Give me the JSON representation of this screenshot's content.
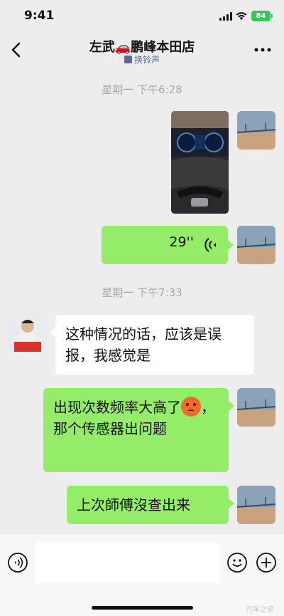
{
  "status_bar": {
    "time": "9:41",
    "battery": "84"
  },
  "header": {
    "title": "左武🚗鹏峰本田店",
    "subtitle": "换铃声"
  },
  "messages": {
    "timestamp_1": "星期一 下午6:28",
    "voice_duration": "29''",
    "timestamp_2": "星期一 下午7:33",
    "incoming_text": "这种情况的话，应该是误报，我感觉是",
    "outgoing_1_part1": "出现次数频率大高了",
    "outgoing_1_part2": "，那个传感器出问题",
    "outgoing_2": "上次師傅沒查出来"
  },
  "input_bar": {
    "placeholder": ""
  },
  "watermark": "汽车之家",
  "colors": {
    "bubble_out": "#95ec69",
    "bubble_in": "#ffffff",
    "background": "#ededed",
    "link_blue": "#576b95",
    "battery_green": "#34c759"
  }
}
